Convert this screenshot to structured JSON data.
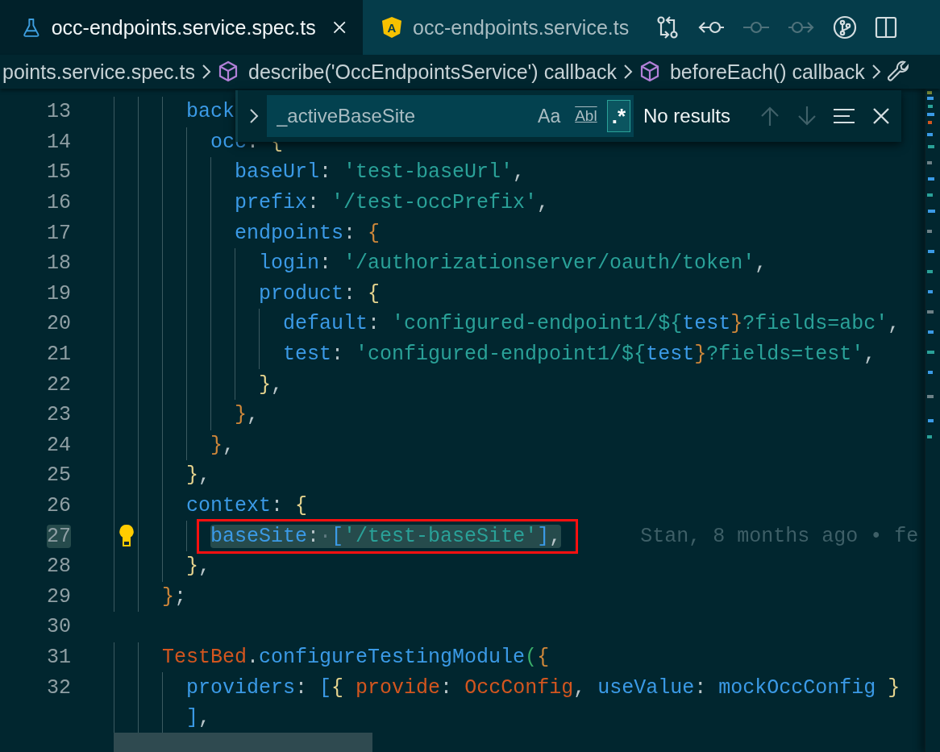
{
  "tabs": [
    {
      "label": "occ-endpoints.service.spec.ts",
      "kind": "test",
      "selected": true,
      "closable": true
    },
    {
      "label": "occ-endpoints.service.ts",
      "kind": "angular",
      "badge": "A",
      "selected": false,
      "closable": false
    }
  ],
  "toolbar": [
    {
      "kind": "compare",
      "disabled": false
    },
    {
      "kind": "back",
      "disabled": false
    },
    {
      "kind": "commit",
      "disabled": true
    },
    {
      "kind": "forward",
      "disabled": true
    },
    {
      "kind": "git",
      "disabled": false
    },
    {
      "kind": "split",
      "disabled": false
    }
  ],
  "breadcrumbs": [
    {
      "kind": "file",
      "label": "points.service.spec.ts"
    },
    {
      "kind": "symbol",
      "label": "describe('OccEndpointsService') callback"
    },
    {
      "kind": "symbol",
      "label": "beforeEach() callback"
    },
    {
      "kind": "property"
    }
  ],
  "find": {
    "expanded": false,
    "value": "_activeBaseSite",
    "result": "No results",
    "toggles": [
      {
        "kind": "case",
        "label": "Aa",
        "on": false
      },
      {
        "kind": "word",
        "label": "Abl",
        "on": false
      },
      {
        "kind": "regex",
        "label": ".*",
        "on": true
      }
    ],
    "nav": [
      {
        "kind": "up",
        "disabled": true
      },
      {
        "kind": "down",
        "disabled": true
      },
      {
        "kind": "selection",
        "disabled": false
      },
      {
        "kind": "close",
        "disabled": false
      }
    ]
  },
  "lines": [
    {
      "number": "13",
      "highlighted": false,
      "lightbulb": false,
      "tokens": [
        {
          "kind": "key",
          "text": "      back"
        }
      ]
    },
    {
      "number": "14",
      "highlighted": false,
      "lightbulb": false,
      "tokens": [
        {
          "kind": "key",
          "text": "        occ"
        },
        {
          "kind": "punct",
          "text": ": "
        },
        {
          "kind": "brace1",
          "text": "{"
        }
      ]
    },
    {
      "number": "15",
      "highlighted": false,
      "lightbulb": false,
      "tokens": [
        {
          "kind": "key",
          "text": "          baseUrl"
        },
        {
          "kind": "punct",
          "text": ": "
        },
        {
          "kind": "string",
          "text": "'test-baseUrl'"
        },
        {
          "kind": "punct",
          "text": ","
        }
      ]
    },
    {
      "number": "16",
      "highlighted": false,
      "lightbulb": false,
      "tokens": [
        {
          "kind": "key",
          "text": "          prefix"
        },
        {
          "kind": "punct",
          "text": ": "
        },
        {
          "kind": "string",
          "text": "'/test-occPrefix'"
        },
        {
          "kind": "punct",
          "text": ","
        }
      ]
    },
    {
      "number": "17",
      "highlighted": false,
      "lightbulb": false,
      "tokens": [
        {
          "kind": "key",
          "text": "          endpoints"
        },
        {
          "kind": "punct",
          "text": ": "
        },
        {
          "kind": "brace2",
          "text": "{"
        }
      ]
    },
    {
      "number": "18",
      "highlighted": false,
      "lightbulb": false,
      "tokens": [
        {
          "kind": "key",
          "text": "            login"
        },
        {
          "kind": "punct",
          "text": ": "
        },
        {
          "kind": "string",
          "text": "'/authorizationserver/oauth/token'"
        },
        {
          "kind": "punct",
          "text": ","
        }
      ]
    },
    {
      "number": "19",
      "highlighted": false,
      "lightbulb": false,
      "tokens": [
        {
          "kind": "key",
          "text": "            product"
        },
        {
          "kind": "punct",
          "text": ": "
        },
        {
          "kind": "brace1",
          "text": "{"
        }
      ]
    },
    {
      "number": "20",
      "highlighted": false,
      "lightbulb": false,
      "tokens": [
        {
          "kind": "key",
          "text": "              default"
        },
        {
          "kind": "punct",
          "text": ": "
        },
        {
          "kind": "string",
          "text": "'configured-endpoint1/${"
        },
        {
          "kind": "key",
          "text": "test"
        },
        {
          "kind": "brace2",
          "text": "}"
        },
        {
          "kind": "string",
          "text": "?fields=abc'"
        },
        {
          "kind": "punct",
          "text": ","
        }
      ]
    },
    {
      "number": "21",
      "highlighted": false,
      "lightbulb": false,
      "tokens": [
        {
          "kind": "key",
          "text": "              test"
        },
        {
          "kind": "punct",
          "text": ": "
        },
        {
          "kind": "string",
          "text": "'configured-endpoint1/${"
        },
        {
          "kind": "key",
          "text": "test"
        },
        {
          "kind": "brace2",
          "text": "}"
        },
        {
          "kind": "string",
          "text": "?fields=test'"
        },
        {
          "kind": "punct",
          "text": ","
        }
      ]
    },
    {
      "number": "22",
      "highlighted": false,
      "lightbulb": false,
      "tokens": [
        {
          "kind": "brace1",
          "text": "            }"
        },
        {
          "kind": "punct",
          "text": ","
        }
      ]
    },
    {
      "number": "23",
      "highlighted": false,
      "lightbulb": false,
      "tokens": [
        {
          "kind": "brace2",
          "text": "          }"
        },
        {
          "kind": "punct",
          "text": ","
        }
      ]
    },
    {
      "number": "24",
      "highlighted": false,
      "lightbulb": false,
      "tokens": [
        {
          "kind": "brace2",
          "text": "        }"
        },
        {
          "kind": "punct",
          "text": ","
        }
      ]
    },
    {
      "number": "25",
      "highlighted": false,
      "lightbulb": false,
      "tokens": [
        {
          "kind": "brace1",
          "text": "      }"
        },
        {
          "kind": "punct",
          "text": ","
        }
      ]
    },
    {
      "number": "26",
      "highlighted": false,
      "lightbulb": false,
      "tokens": [
        {
          "kind": "key",
          "text": "      context"
        },
        {
          "kind": "punct",
          "text": ": "
        },
        {
          "kind": "brace1",
          "text": "{"
        }
      ]
    },
    {
      "number": "27",
      "highlighted": true,
      "lightbulb": true,
      "blame": "Stan, 8 months ago • fe",
      "tokens": [
        {
          "kind": "key",
          "text": "        baseSite"
        },
        {
          "kind": "punct",
          "text": ":"
        },
        {
          "kind": "dot",
          "text": "·"
        },
        {
          "kind": "bracket",
          "text": "["
        },
        {
          "kind": "string",
          "text": "'/test-baseSite'"
        },
        {
          "kind": "bracket",
          "text": "]"
        },
        {
          "kind": "punct",
          "text": ","
        }
      ]
    },
    {
      "number": "28",
      "highlighted": false,
      "lightbulb": false,
      "tokens": [
        {
          "kind": "brace1",
          "text": "      }"
        },
        {
          "kind": "punct",
          "text": ","
        }
      ]
    },
    {
      "number": "29",
      "highlighted": false,
      "lightbulb": false,
      "tokens": [
        {
          "kind": "brace2",
          "text": "    }"
        },
        {
          "kind": "punct",
          "text": ";"
        }
      ]
    },
    {
      "number": "30",
      "highlighted": false,
      "lightbulb": false
    },
    {
      "number": "31",
      "highlighted": false,
      "lightbulb": false,
      "tokens": [
        {
          "kind": "class",
          "text": "    TestBed"
        },
        {
          "kind": "punct",
          "text": "."
        },
        {
          "kind": "key",
          "text": "configureTestingModule"
        },
        {
          "kind": "paren",
          "text": "("
        },
        {
          "kind": "brace2",
          "text": "{"
        }
      ]
    },
    {
      "number": "32",
      "highlighted": false,
      "lightbulb": false,
      "tokens": [
        {
          "kind": "key",
          "text": "      providers"
        },
        {
          "kind": "punct",
          "text": ": "
        },
        {
          "kind": "bracket",
          "text": "["
        },
        {
          "kind": "brace1",
          "text": "{ "
        },
        {
          "kind": "class",
          "text": "provide"
        },
        {
          "kind": "punct",
          "text": ": "
        },
        {
          "kind": "class",
          "text": "OccConfig"
        },
        {
          "kind": "punct",
          "text": ", "
        },
        {
          "kind": "key",
          "text": "useValue"
        },
        {
          "kind": "punct",
          "text": ": "
        },
        {
          "kind": "key",
          "text": "mockOccConfig"
        },
        {
          "kind": "brace1",
          "text": " }"
        }
      ]
    },
    {
      "highlighted": false,
      "lightbulb": false,
      "tokens": [
        {
          "kind": "bracket",
          "text": "      ]"
        },
        {
          "kind": "punct",
          "text": ","
        }
      ]
    }
  ]
}
